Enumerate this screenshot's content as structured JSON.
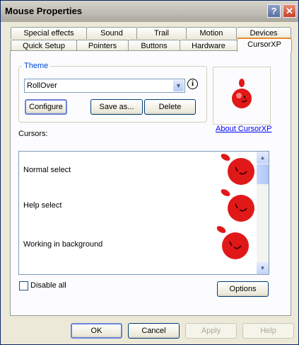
{
  "window": {
    "title": "Mouse Properties",
    "help_glyph": "?",
    "close_glyph": "✕"
  },
  "tabs_row1": [
    "Special effects",
    "Sound",
    "Trail",
    "Motion",
    "Devices"
  ],
  "tabs_row2": [
    "Quick Setup",
    "Pointers",
    "Buttons",
    "Hardware",
    "CursorXP"
  ],
  "active_tab": "CursorXP",
  "theme": {
    "legend": "Theme",
    "selected": "RollOver",
    "info_glyph": "i",
    "configure_label": "Configure",
    "save_as_label": "Save as...",
    "delete_label": "Delete"
  },
  "about_link": "About CursorXP",
  "cursors": {
    "label": "Cursors:",
    "rows": [
      "Normal select",
      "Help select",
      "Working in background"
    ]
  },
  "disable_all_label": "Disable all",
  "disable_all_checked": false,
  "options_label": "Options",
  "footer": {
    "ok": "OK",
    "cancel": "Cancel",
    "apply": "Apply",
    "help": "Help"
  },
  "colors": {
    "accent": "#e68b2c",
    "ball": "#e01818",
    "link": "#0000ff"
  }
}
